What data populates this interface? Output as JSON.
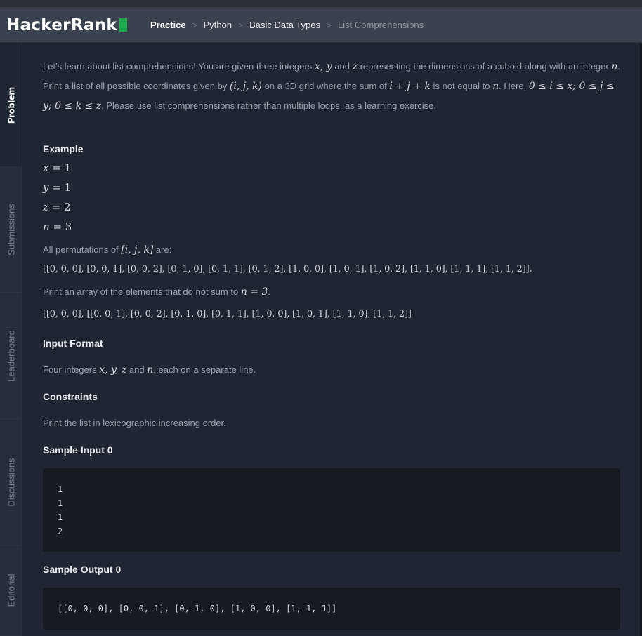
{
  "brand": {
    "name": "HackerRank"
  },
  "breadcrumb": [
    "Practice",
    "Python",
    "Basic Data Types",
    "List Comprehensions"
  ],
  "sidebar": {
    "tabs": [
      "Problem",
      "Submissions",
      "Leaderboard",
      "Discussions",
      "Editorial"
    ]
  },
  "problem": {
    "intro": {
      "t1": "Let's learn about list comprehensions! You are given three integers ",
      "m_xy": "x, y",
      "t2": " and ",
      "m_z": "z",
      "t3": " representing the dimensions of a cuboid along with an integer ",
      "m_n": "n",
      "t4": ". Print a list of all possible coordinates given by ",
      "m_ijk": "(i, j, k)",
      "t5": " on a 3D grid where the sum of ",
      "m_sum": "i + j + k",
      "t6": " is not equal to ",
      "m_n2": "n",
      "t7": ". Here, ",
      "m_range": "0 ≤ i ≤ x; 0 ≤ j ≤ y; 0 ≤ k ≤ z",
      "t8": ". Please use list comprehensions rather than multiple loops, as a learning exercise."
    },
    "example_heading": "Example",
    "example_vars": [
      {
        "name": "x",
        "rest": " = 1"
      },
      {
        "name": "y",
        "rest": " = 1"
      },
      {
        "name": "z",
        "rest": " = 2"
      },
      {
        "name": "n",
        "rest": " = 3"
      }
    ],
    "perm_text": "All permutations of ",
    "perm_math": "[i, j, k]",
    "perm_suffix": " are:",
    "all_perms": "[[0, 0, 0], [0, 0, 1], [0, 0, 2], [0, 1, 0], [0, 1, 1], [0, 1, 2], [1, 0, 0], [1, 0, 1], [1, 0, 2], [1, 1, 0], [1, 1, 1], [1, 1, 2]].",
    "print_text": "Print an array of the elements that do not sum to ",
    "print_math": "n = 3",
    "print_suffix": ".",
    "filtered": "[[0, 0, 1], [0, 0, 2], [0, 1, 0], [0, 1, 1], [1, 0, 0], [1, 0, 1], [1, 1, 0], [1, 1, 2]]",
    "filtered_prefix": "[[0, 0, 0], ",
    "input_heading": "Input Format",
    "input_text1": "Four integers ",
    "input_math": "x, y, z",
    "input_text2": " and ",
    "input_math2": "n",
    "input_text3": ", each on a separate line.",
    "constraints_heading": "Constraints",
    "constraints_text": "Print the list in lexicographic increasing order.",
    "sample_input_heading": "Sample Input 0",
    "sample_input": "1\n1\n1\n2",
    "sample_output_heading": "Sample Output 0",
    "sample_output": "[[0, 0, 0], [0, 0, 1], [0, 1, 0], [1, 0, 0], [1, 1, 1]]"
  }
}
